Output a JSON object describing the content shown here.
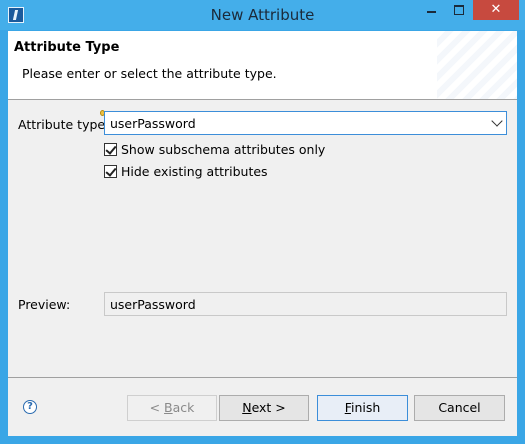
{
  "window": {
    "title": "New Attribute",
    "min_icon": "minimize-icon",
    "max_icon": "maximize-icon",
    "close_glyph": "✕"
  },
  "header": {
    "title": "Attribute Type",
    "description": "Please enter or select the attribute type."
  },
  "form": {
    "attribute_type_label": "Attribute type:",
    "attribute_type_value": "userPassword",
    "show_subschema_label": "Show subschema attributes only",
    "show_subschema_checked": true,
    "hide_existing_label": "Hide existing attributes",
    "hide_existing_checked": true,
    "preview_label": "Preview:",
    "preview_value": "userPassword"
  },
  "footer": {
    "help_glyph": "?",
    "back_prefix": "< ",
    "back_mnemonic": "B",
    "back_rest": "ack",
    "next_mnemonic": "N",
    "next_rest": "ext >",
    "finish_mnemonic": "F",
    "finish_rest": "inish",
    "cancel_label": "Cancel"
  }
}
